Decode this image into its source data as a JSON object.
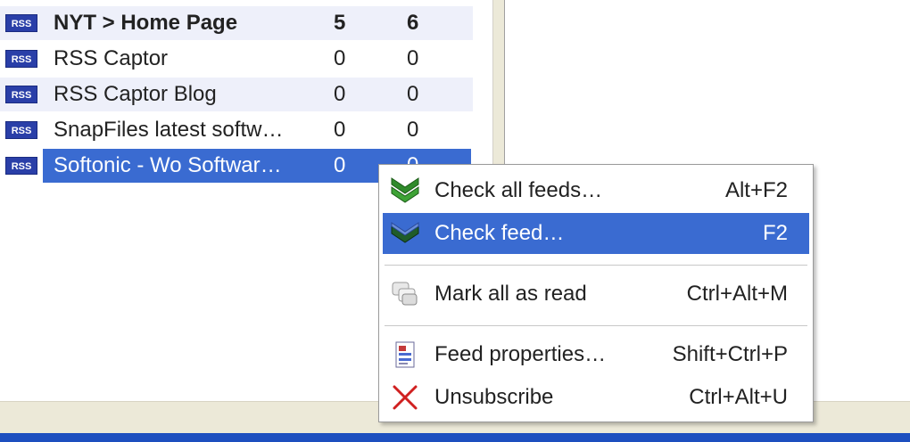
{
  "feeds": [
    {
      "title": "NYT > Home Page",
      "unread": "5",
      "total": "6"
    },
    {
      "title": "RSS Captor",
      "unread": "0",
      "total": "0"
    },
    {
      "title": "RSS Captor Blog",
      "unread": "0",
      "total": "0"
    },
    {
      "title": "SnapFiles latest softw…",
      "unread": "0",
      "total": "0"
    },
    {
      "title": "Softonic - Wo Softwar…",
      "unread": "0",
      "total": "0"
    }
  ],
  "rss_badge": "RSS",
  "context_menu": {
    "items": [
      {
        "label": "Check all feeds…",
        "shortcut": "Alt+F2",
        "icon": "check-all-feeds-icon"
      },
      {
        "label": "Check feed…",
        "shortcut": "F2",
        "icon": "check-feed-icon"
      },
      {
        "label": "Mark all as read",
        "shortcut": "Ctrl+Alt+M",
        "icon": "mark-read-icon"
      },
      {
        "label": "Feed properties…",
        "shortcut": "Shift+Ctrl+P",
        "icon": "properties-icon"
      },
      {
        "label": "Unsubscribe",
        "shortcut": "Ctrl+Alt+U",
        "icon": "unsubscribe-icon"
      }
    ]
  },
  "colors": {
    "selection": "#3a6bd1",
    "rss_badge": "#2a3fa8",
    "taskbar": "#1d4fbf"
  }
}
